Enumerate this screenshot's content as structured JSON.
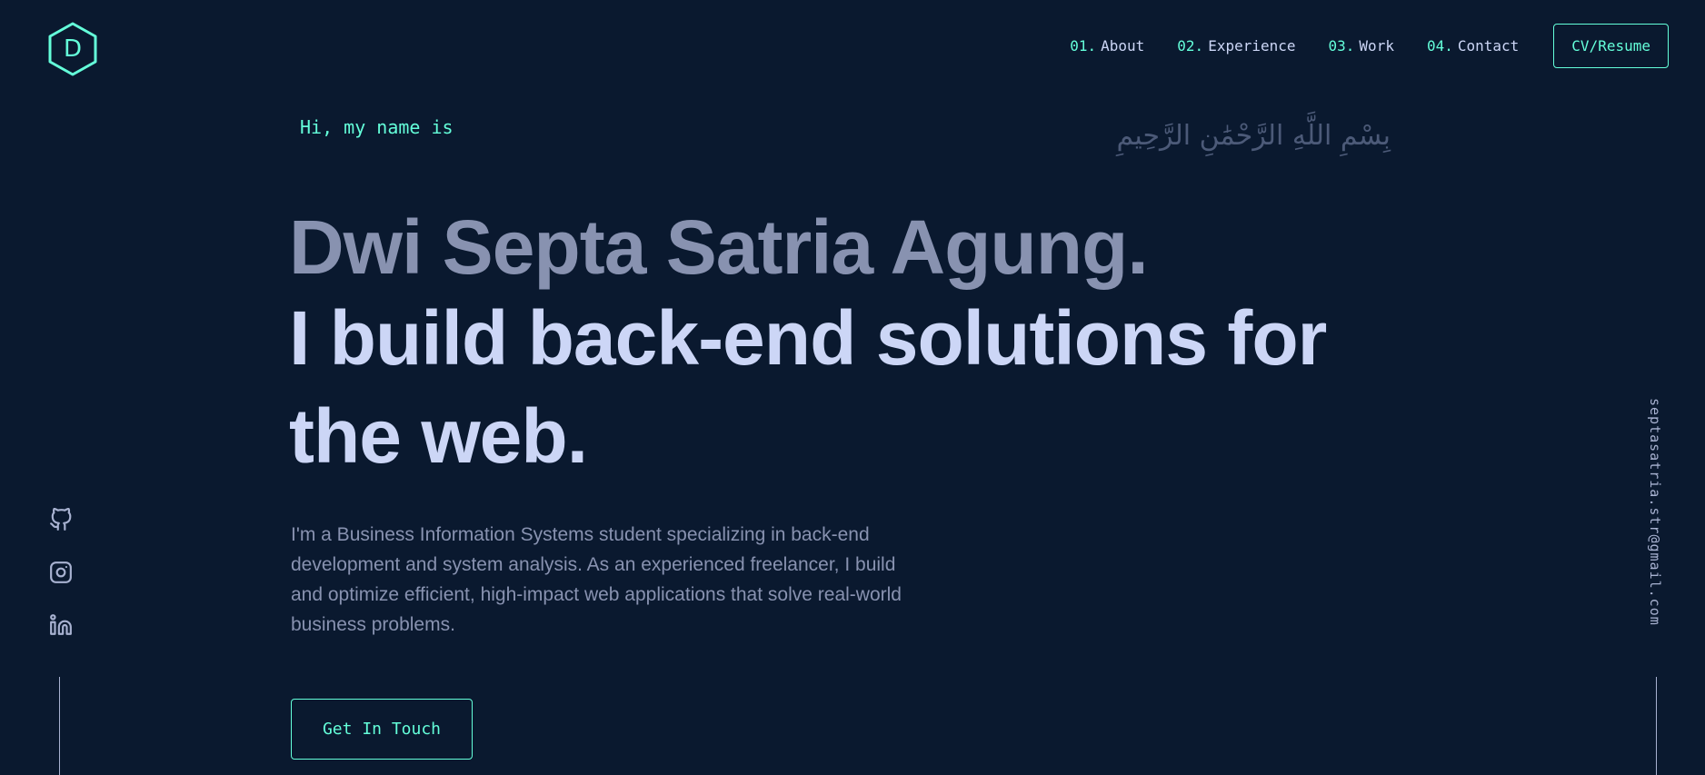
{
  "logo": {
    "letter": "D",
    "icon": "hexagon-logo-icon"
  },
  "nav": {
    "items": [
      {
        "num": "01.",
        "label": "About"
      },
      {
        "num": "02.",
        "label": "Experience"
      },
      {
        "num": "03.",
        "label": "Work"
      },
      {
        "num": "04.",
        "label": "Contact"
      }
    ],
    "resume_label": "CV/Resume"
  },
  "hero": {
    "greeting": "Hi, my name is",
    "arabic": "بِسْمِ اللَّهِ الرَّحْمَٰنِ الرَّحِيمِ",
    "name": "Dwi Septa Satria Agung.",
    "tagline": "I build back-end solutions for the web.",
    "intro": "I'm a Business Information Systems student specializing in back-end development and system analysis. As an experienced freelancer, I build and optimize efficient, high-impact web applications that solve real-world business problems.",
    "cta_label": "Get In Touch"
  },
  "socials": [
    {
      "icon": "github-icon"
    },
    {
      "icon": "instagram-icon"
    },
    {
      "icon": "linkedin-icon"
    }
  ],
  "email": "septasatria.str@gmail.com",
  "colors": {
    "background": "#0a192f",
    "accent": "#64ffda",
    "heading": "#ccd6f6",
    "text": "#8892b0"
  }
}
